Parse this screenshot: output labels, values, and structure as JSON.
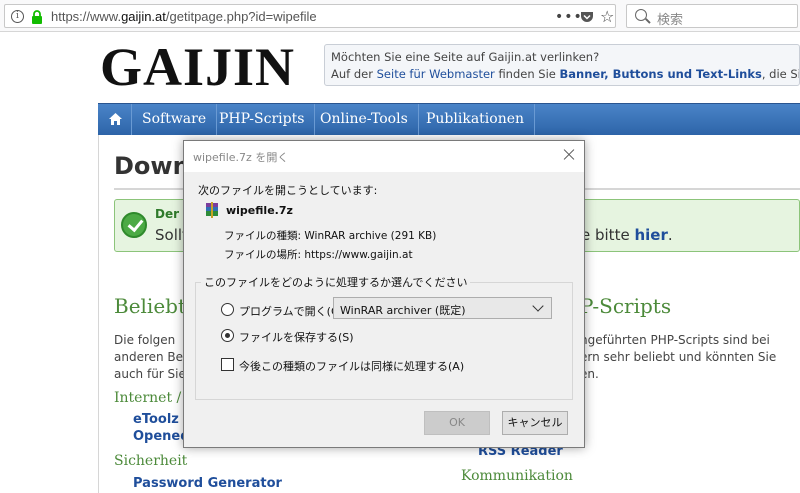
{
  "browser": {
    "url_prefix": "https://www.",
    "url_domain": "gaijin.at",
    "url_path": "/getitpage.php?id=wipefile",
    "more_label": "•••",
    "search_placeholder": "検索"
  },
  "page": {
    "logo": "GAIJIN",
    "promo": {
      "line1": "Möchten Sie eine Seite auf Gaijin.at verlinken?",
      "line2_pre": "Auf der",
      "line2_link1": "Seite für Webmaster",
      "line2_mid": "finden Sie",
      "line2_link2": "Banner, Buttons und Text-Links",
      "line2_post": ", die Sie in Ih"
    },
    "nav": [
      {
        "label": "Software"
      },
      {
        "label": "PHP-Scripts"
      },
      {
        "label": "Online-Tools"
      },
      {
        "label": "Publikationen"
      }
    ],
    "title": "Downl",
    "notice": {
      "heading": "Der",
      "body": "Sollt",
      "tail_pre": "e bitte",
      "tail_link": "hier",
      "tail_post": "."
    },
    "section_left": "Beliebte",
    "section_right": "P-Scripts",
    "para_left": "Die folgen anderen Be auch für Sie",
    "para_right": "ngeführten PHP-Scripts sind bei ern sehr beliebt und könnten Sie en.",
    "sub_internet": "Internet / I",
    "link_etoolz": "eToolz",
    "link_opened": "Opened",
    "sub_sicherheit": "Sicherheit",
    "link_password": "Password Generator",
    "link_rss": "RSS Reader",
    "sub_kommunikation": "Kommunikation"
  },
  "dialog": {
    "title": "wipefile.7z を開く",
    "intro": "次のファイルを開こうとしています:",
    "file_name": "wipefile.7z",
    "type_label": "ファイルの種類:",
    "type_value": "WinRAR archive (291 KB)",
    "location_label": "ファイルの場所:",
    "location_value": "https://www.gaijin.at",
    "group_label": "このファイルをどのように処理するか選んでください",
    "open_with_label": "プログラムで開く(O):",
    "open_with_app": "WinRAR archiver (既定)",
    "save_label": "ファイルを保存する(S)",
    "remember_label": "今後この種類のファイルは同様に処理する(A)",
    "ok_label": "OK",
    "cancel_label": "キャンセル",
    "selected_option": "save"
  },
  "colors": {
    "nav_blue": "#2d64a8",
    "link_blue": "#1f4e9b",
    "section_green": "#4c8a3a",
    "notice_bg": "#e6f4e0"
  }
}
